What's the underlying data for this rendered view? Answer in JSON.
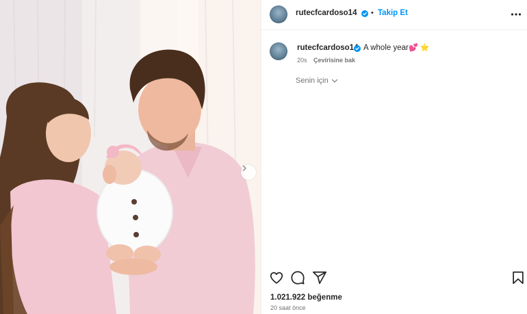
{
  "post": {
    "username": "rutecfcardoso14",
    "separator": "•",
    "follow_label": "Takip Et",
    "more_icon": "more-horizontal-icon",
    "verified_color": "#0095f6"
  },
  "caption": {
    "username": "rutecfcardoso14",
    "text": "A whole year",
    "emojis": "💕 ⭐",
    "age": "20s",
    "translate_label": "Çevirisine bak"
  },
  "for_you": {
    "label": "Senin için"
  },
  "actions": {
    "like_icon": "heart-icon",
    "comment_icon": "comment-icon",
    "share_icon": "share-icon",
    "save_icon": "bookmark-icon"
  },
  "stats": {
    "likes": "1.021.922 beğenme",
    "posted": "20 saat önce"
  },
  "media": {
    "next_icon": "chevron-right-icon",
    "accent": "#0095f6"
  }
}
